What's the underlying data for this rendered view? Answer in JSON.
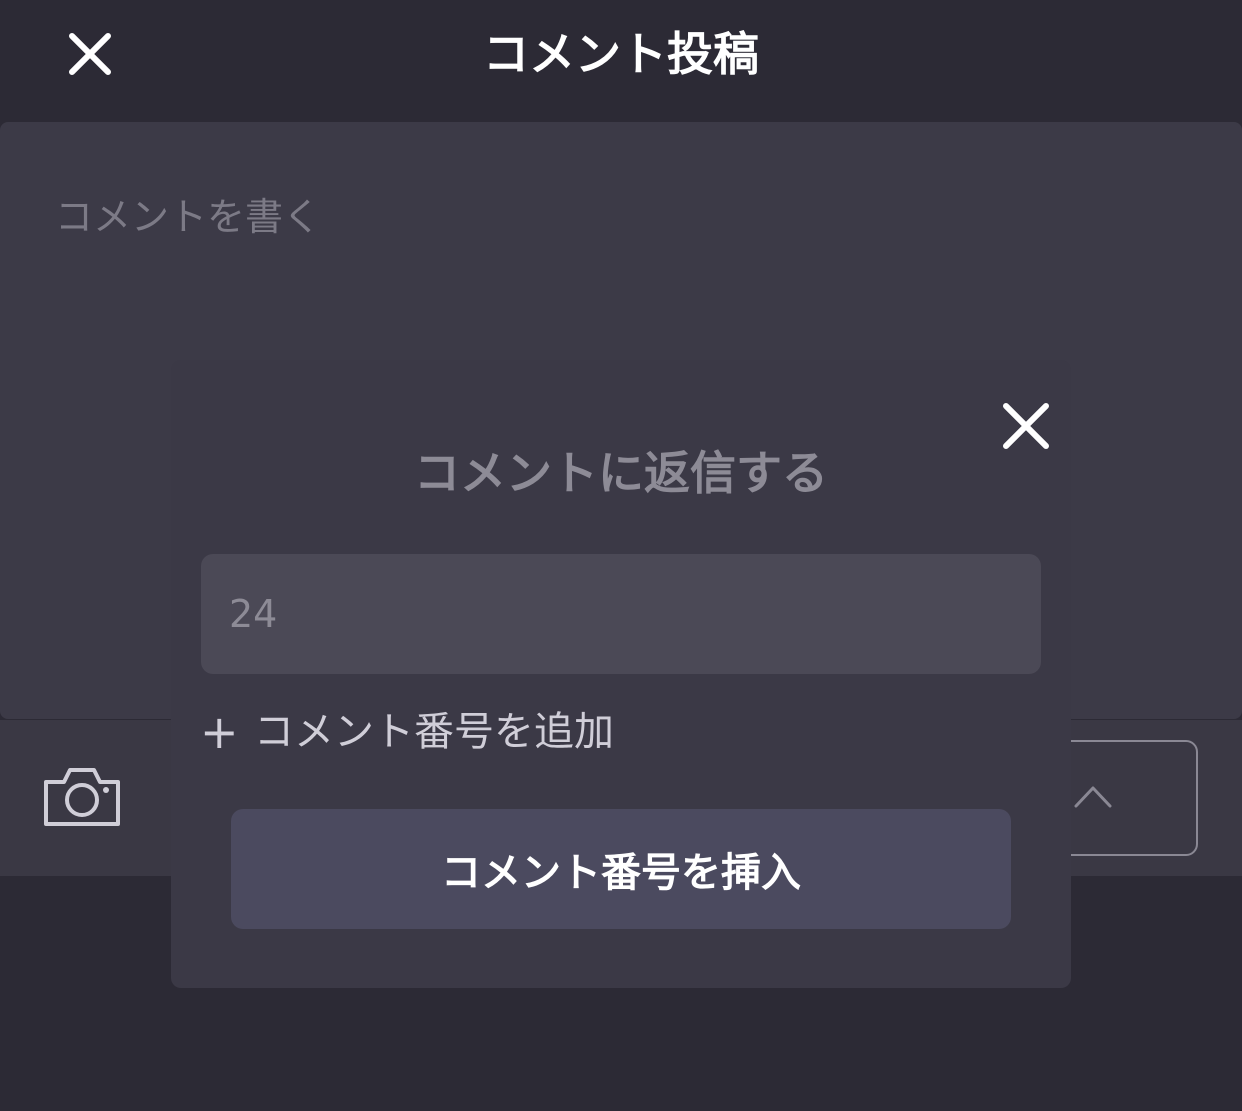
{
  "header": {
    "title": "コメント投稿",
    "close_icon": "close-icon"
  },
  "editor": {
    "placeholder": "コメントを書く"
  },
  "toolbar": {
    "camera_icon": "camera-icon",
    "send_icon": "chevron-up-icon"
  },
  "modal": {
    "title": "コメントに返信する",
    "input_placeholder": "24",
    "add_label": "コメント番号を追加",
    "add_icon": "+",
    "insert_label": "コメント番号を挿入",
    "close_icon": "close-icon"
  },
  "colors": {
    "background": "#2c2a35",
    "editor": "#3c3a47",
    "modal": "#3b3946",
    "input": "#4b4956",
    "button": "#4b4a5f"
  }
}
